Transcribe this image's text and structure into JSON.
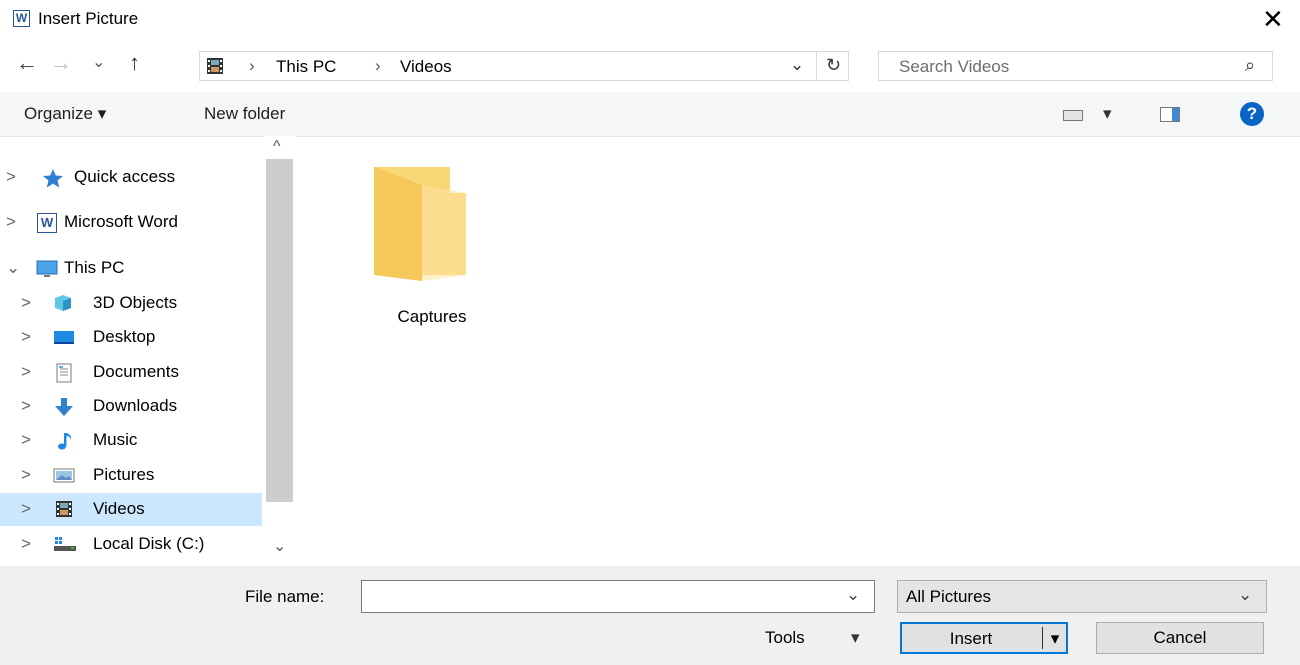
{
  "window": {
    "title": "Insert Picture",
    "app_icon_letter": "W",
    "close_glyph": "✕"
  },
  "nav_buttons": {
    "back": "←",
    "forward": "→",
    "recent": "⌄",
    "up": "↑"
  },
  "address": {
    "segments": [
      "This PC",
      "Videos"
    ],
    "separator": "›",
    "dropdown": "⌄",
    "refresh": "↻"
  },
  "search": {
    "placeholder": "Search Videos",
    "icon": "⌕"
  },
  "toolbar": {
    "organize": "Organize ▾",
    "new_folder": "New folder",
    "view_dropdown": "▾",
    "help": "?"
  },
  "nav_pane": {
    "items": [
      {
        "label": "Quick access",
        "icon": "star-icon",
        "chevron": ">"
      },
      {
        "label": "Microsoft Word",
        "icon": "word-icon",
        "chevron": ">"
      },
      {
        "label": "This PC",
        "icon": "pc-icon",
        "chevron": "⌄"
      },
      {
        "label": "3D Objects",
        "icon": "3d-objects-icon",
        "chevron": ">"
      },
      {
        "label": "Desktop",
        "icon": "desktop-icon",
        "chevron": ">"
      },
      {
        "label": "Documents",
        "icon": "documents-icon",
        "chevron": ">"
      },
      {
        "label": "Downloads",
        "icon": "downloads-icon",
        "chevron": ">"
      },
      {
        "label": "Music",
        "icon": "music-icon",
        "chevron": ">"
      },
      {
        "label": "Pictures",
        "icon": "pictures-icon",
        "chevron": ">"
      },
      {
        "label": "Videos",
        "icon": "videos-icon",
        "chevron": ">",
        "selected": true
      },
      {
        "label": "Local Disk (C:)",
        "icon": "disk-icon",
        "chevron": ">"
      }
    ],
    "scroll_up": "^",
    "scroll_down": "⌄"
  },
  "content": {
    "items": [
      {
        "label": "Captures",
        "icon": "folder-icon"
      }
    ]
  },
  "bottom": {
    "file_name_label": "File name:",
    "file_name_value": "",
    "file_name_dropdown": "⌄",
    "filter_value": "All Pictures",
    "filter_dropdown": "⌄",
    "tools_label": "Tools",
    "tools_arrow": "▾",
    "insert_label": "Insert",
    "insert_arrow": "▾",
    "cancel_label": "Cancel"
  },
  "colors": {
    "accent": "#0078d7",
    "selection": "#cce8ff",
    "folder": "#f8d775",
    "word_blue": "#2b579a"
  }
}
